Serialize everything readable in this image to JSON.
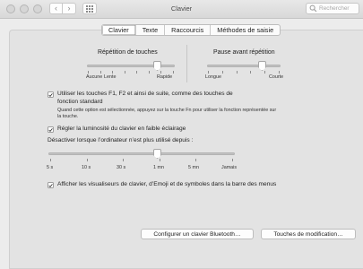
{
  "window": {
    "title": "Clavier",
    "search_placeholder": "Rechercher"
  },
  "tabs": [
    {
      "label": "Clavier",
      "selected": true
    },
    {
      "label": "Texte",
      "selected": false
    },
    {
      "label": "Raccourcis",
      "selected": false
    },
    {
      "label": "Méthodes de saisie",
      "selected": false
    }
  ],
  "key_repeat": {
    "title": "Répétition de touches",
    "labels": [
      "Aucune",
      "Lente",
      "Rapide"
    ]
  },
  "delay_until_repeat": {
    "title": "Pause avant répétition",
    "labels": [
      "Longue",
      "Courte"
    ]
  },
  "fn_keys": {
    "label_line1": "Utiliser les touches F1, F2 et ainsi de suite, comme des touches de",
    "label_line2": "fonction standard",
    "note_line1": "Quand cette option est sélectionnée, appuyez sur la touche Fn pour utiliser la fonction représentée sur",
    "note_line2": "la touche.",
    "checked": true
  },
  "brightness": {
    "label": "Régler la luminosité du clavier en faible éclairage",
    "checked": true
  },
  "backlight_off": {
    "label": "Désactiver lorsque l’ordinateur n’est plus utilisé depuis :",
    "ticks": [
      "5 s",
      "10 s",
      "30 s",
      "1 mn",
      "5 mn",
      "Jamais"
    ]
  },
  "viewers": {
    "label": "Afficher les visualiseurs de clavier, d’Emoji et de symboles dans la barre des menus",
    "checked": true
  },
  "buttons": {
    "bluetooth": "Configurer un clavier Bluetooth…",
    "modifier": "Touches de modification…"
  }
}
